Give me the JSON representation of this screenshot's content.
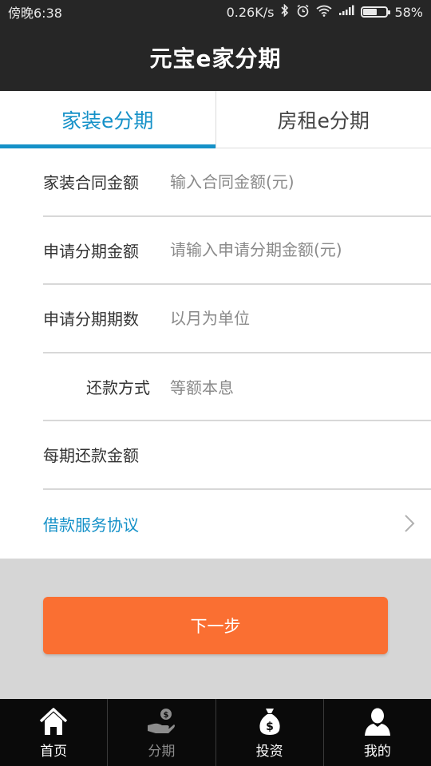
{
  "status_bar": {
    "time": "傍晚6:38",
    "network_speed": "0.26K/s",
    "battery_percent": "58%",
    "battery_level": 0.58
  },
  "header": {
    "title": "元宝e家分期"
  },
  "tabs": [
    {
      "label": "家装e分期",
      "active": true
    },
    {
      "label": "房租e分期",
      "active": false
    }
  ],
  "form": {
    "contract_amount": {
      "label": "家装合同金额",
      "placeholder": "输入合同金额(元)"
    },
    "installment_amount": {
      "label": "申请分期金额",
      "placeholder": "请输入申请分期金额(元)"
    },
    "installment_periods": {
      "label": "申请分期期数",
      "placeholder": "以月为单位"
    },
    "repayment_method": {
      "label": "还款方式",
      "value": "等额本息"
    },
    "monthly_repayment": {
      "label": "每期还款金额",
      "value": ""
    },
    "agreement": {
      "label": "借款服务协议"
    }
  },
  "next_button": {
    "label": "下一步"
  },
  "bottom_nav": [
    {
      "label": "首页",
      "icon": "home-icon"
    },
    {
      "label": "分期",
      "icon": "hand-coin-icon"
    },
    {
      "label": "投资",
      "icon": "money-bag-icon"
    },
    {
      "label": "我的",
      "icon": "user-icon"
    }
  ],
  "colors": {
    "accent": "#1591c8",
    "button": "#fa6f32",
    "header_bg": "#262626",
    "nav_bg": "#0a0a0a"
  }
}
